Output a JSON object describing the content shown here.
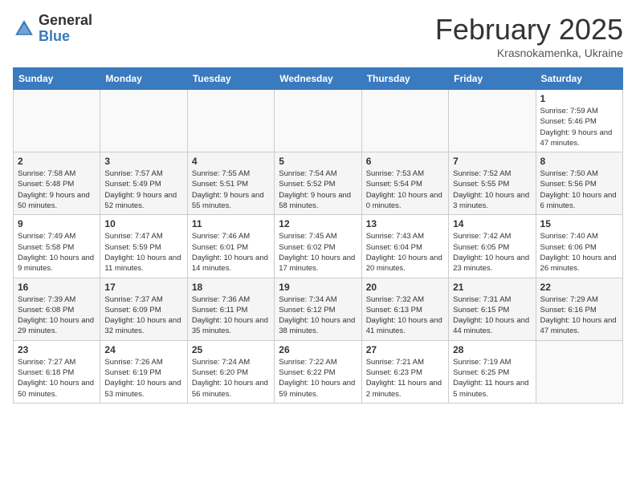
{
  "logo": {
    "general": "General",
    "blue": "Blue"
  },
  "header": {
    "month": "February 2025",
    "location": "Krasnokamenka, Ukraine"
  },
  "columns": [
    "Sunday",
    "Monday",
    "Tuesday",
    "Wednesday",
    "Thursday",
    "Friday",
    "Saturday"
  ],
  "weeks": [
    [
      {
        "day": "",
        "info": ""
      },
      {
        "day": "",
        "info": ""
      },
      {
        "day": "",
        "info": ""
      },
      {
        "day": "",
        "info": ""
      },
      {
        "day": "",
        "info": ""
      },
      {
        "day": "",
        "info": ""
      },
      {
        "day": "1",
        "info": "Sunrise: 7:59 AM\nSunset: 5:46 PM\nDaylight: 9 hours and 47 minutes."
      }
    ],
    [
      {
        "day": "2",
        "info": "Sunrise: 7:58 AM\nSunset: 5:48 PM\nDaylight: 9 hours and 50 minutes."
      },
      {
        "day": "3",
        "info": "Sunrise: 7:57 AM\nSunset: 5:49 PM\nDaylight: 9 hours and 52 minutes."
      },
      {
        "day": "4",
        "info": "Sunrise: 7:55 AM\nSunset: 5:51 PM\nDaylight: 9 hours and 55 minutes."
      },
      {
        "day": "5",
        "info": "Sunrise: 7:54 AM\nSunset: 5:52 PM\nDaylight: 9 hours and 58 minutes."
      },
      {
        "day": "6",
        "info": "Sunrise: 7:53 AM\nSunset: 5:54 PM\nDaylight: 10 hours and 0 minutes."
      },
      {
        "day": "7",
        "info": "Sunrise: 7:52 AM\nSunset: 5:55 PM\nDaylight: 10 hours and 3 minutes."
      },
      {
        "day": "8",
        "info": "Sunrise: 7:50 AM\nSunset: 5:56 PM\nDaylight: 10 hours and 6 minutes."
      }
    ],
    [
      {
        "day": "9",
        "info": "Sunrise: 7:49 AM\nSunset: 5:58 PM\nDaylight: 10 hours and 9 minutes."
      },
      {
        "day": "10",
        "info": "Sunrise: 7:47 AM\nSunset: 5:59 PM\nDaylight: 10 hours and 11 minutes."
      },
      {
        "day": "11",
        "info": "Sunrise: 7:46 AM\nSunset: 6:01 PM\nDaylight: 10 hours and 14 minutes."
      },
      {
        "day": "12",
        "info": "Sunrise: 7:45 AM\nSunset: 6:02 PM\nDaylight: 10 hours and 17 minutes."
      },
      {
        "day": "13",
        "info": "Sunrise: 7:43 AM\nSunset: 6:04 PM\nDaylight: 10 hours and 20 minutes."
      },
      {
        "day": "14",
        "info": "Sunrise: 7:42 AM\nSunset: 6:05 PM\nDaylight: 10 hours and 23 minutes."
      },
      {
        "day": "15",
        "info": "Sunrise: 7:40 AM\nSunset: 6:06 PM\nDaylight: 10 hours and 26 minutes."
      }
    ],
    [
      {
        "day": "16",
        "info": "Sunrise: 7:39 AM\nSunset: 6:08 PM\nDaylight: 10 hours and 29 minutes."
      },
      {
        "day": "17",
        "info": "Sunrise: 7:37 AM\nSunset: 6:09 PM\nDaylight: 10 hours and 32 minutes."
      },
      {
        "day": "18",
        "info": "Sunrise: 7:36 AM\nSunset: 6:11 PM\nDaylight: 10 hours and 35 minutes."
      },
      {
        "day": "19",
        "info": "Sunrise: 7:34 AM\nSunset: 6:12 PM\nDaylight: 10 hours and 38 minutes."
      },
      {
        "day": "20",
        "info": "Sunrise: 7:32 AM\nSunset: 6:13 PM\nDaylight: 10 hours and 41 minutes."
      },
      {
        "day": "21",
        "info": "Sunrise: 7:31 AM\nSunset: 6:15 PM\nDaylight: 10 hours and 44 minutes."
      },
      {
        "day": "22",
        "info": "Sunrise: 7:29 AM\nSunset: 6:16 PM\nDaylight: 10 hours and 47 minutes."
      }
    ],
    [
      {
        "day": "23",
        "info": "Sunrise: 7:27 AM\nSunset: 6:18 PM\nDaylight: 10 hours and 50 minutes."
      },
      {
        "day": "24",
        "info": "Sunrise: 7:26 AM\nSunset: 6:19 PM\nDaylight: 10 hours and 53 minutes."
      },
      {
        "day": "25",
        "info": "Sunrise: 7:24 AM\nSunset: 6:20 PM\nDaylight: 10 hours and 56 minutes."
      },
      {
        "day": "26",
        "info": "Sunrise: 7:22 AM\nSunset: 6:22 PM\nDaylight: 10 hours and 59 minutes."
      },
      {
        "day": "27",
        "info": "Sunrise: 7:21 AM\nSunset: 6:23 PM\nDaylight: 11 hours and 2 minutes."
      },
      {
        "day": "28",
        "info": "Sunrise: 7:19 AM\nSunset: 6:25 PM\nDaylight: 11 hours and 5 minutes."
      },
      {
        "day": "",
        "info": ""
      }
    ]
  ]
}
